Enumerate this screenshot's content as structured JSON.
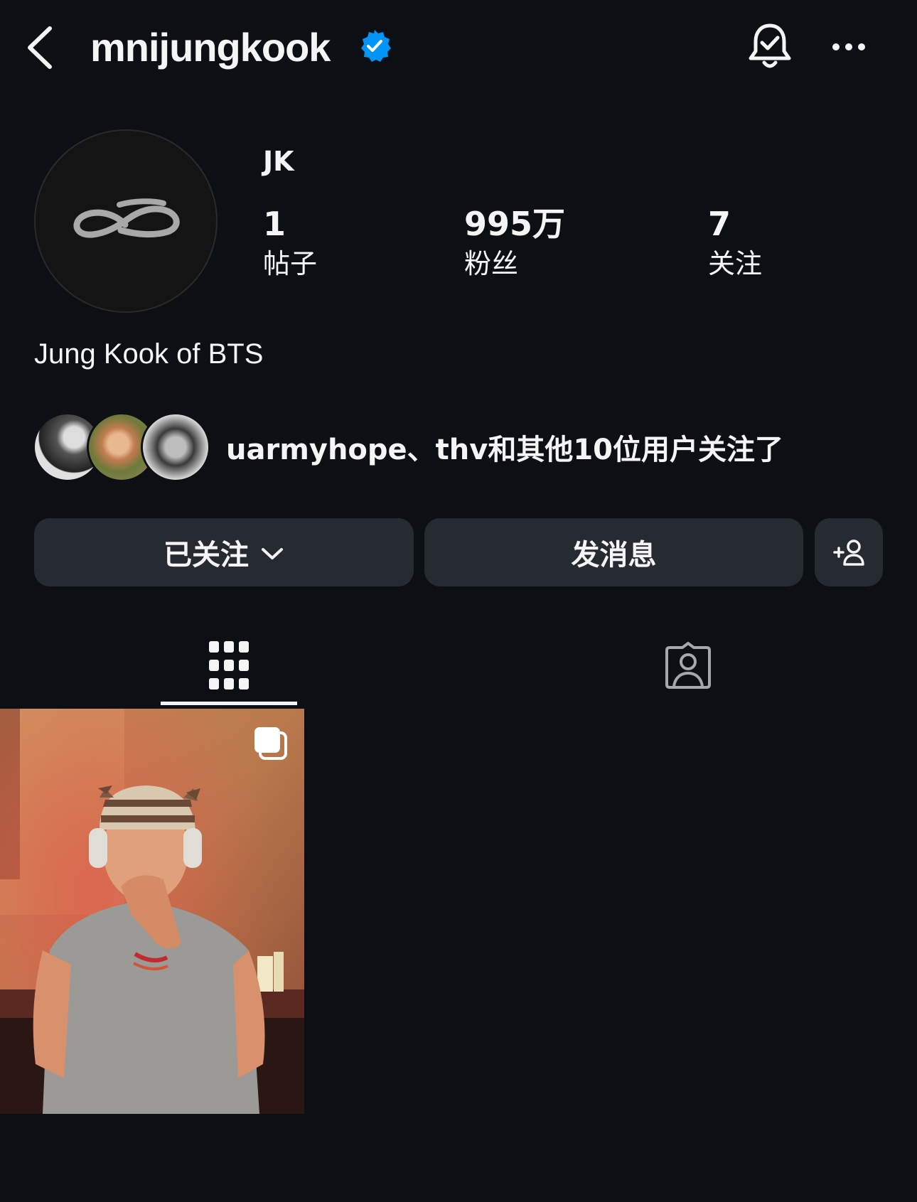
{
  "header": {
    "username": "mnijungkook",
    "verified": true
  },
  "profile": {
    "display_name": "JK",
    "stats": [
      {
        "value": "1",
        "label": "帖子"
      },
      {
        "value": "995万",
        "label": "粉丝"
      },
      {
        "value": "7",
        "label": "关注"
      }
    ],
    "bio": "Jung Kook of BTS"
  },
  "mutual": {
    "text": "uarmyhope、thv和其他10位用户关注了"
  },
  "actions": {
    "following_label": "已关注",
    "message_label": "发消息"
  },
  "tabs": [
    {
      "icon": "grid-icon",
      "active": true
    },
    {
      "icon": "tagged-icon",
      "active": false
    }
  ],
  "posts": [
    {
      "type": "carousel"
    }
  ],
  "colors": {
    "background": "#0c1014",
    "button": "#262b31",
    "verified": "#0095f6",
    "text": "#f5f5f5"
  }
}
